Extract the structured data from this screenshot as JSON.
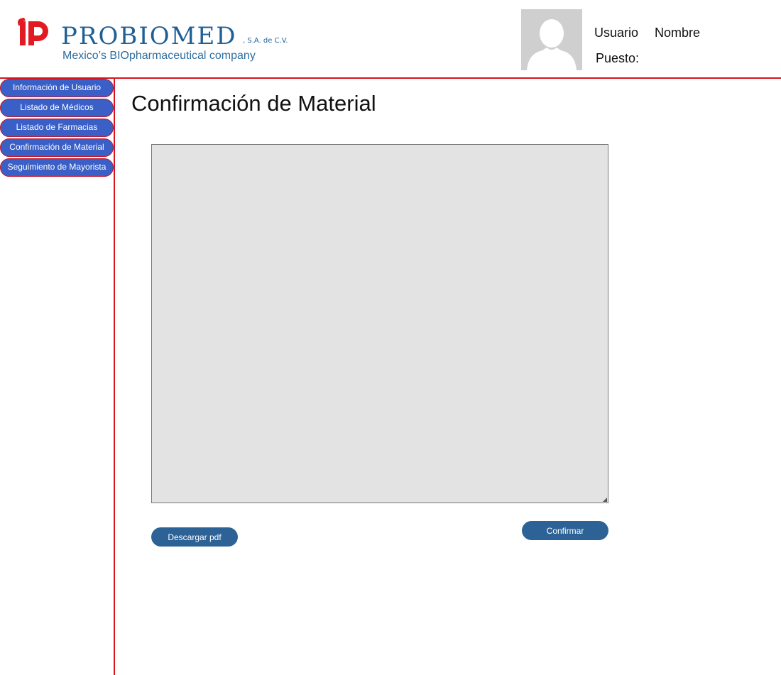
{
  "header": {
    "logo": {
      "name": "PROBIOMED",
      "suffix": ", S.A. de C.V.",
      "tagline": "Mexico’s BIOpharmaceutical company",
      "brand_color": "#1f5f94",
      "mark_color": "#e21b23"
    },
    "user": {
      "label": "Usuario",
      "name": "Nombre",
      "position_label": "Puesto:",
      "avatar_icon": "user-silhouette-icon"
    }
  },
  "sidebar": {
    "items": [
      {
        "label": "Información de Usuario"
      },
      {
        "label": "Listado de Médicos"
      },
      {
        "label": "Listado de Farmacias"
      },
      {
        "label": "Confirmación de Material"
      },
      {
        "label": "Seguimiento de Mayorista"
      }
    ]
  },
  "main": {
    "title": "Confirmación de Material",
    "download_label": "Descargar pdf",
    "confirm_label": "Confirmar"
  },
  "colors": {
    "accent_red": "#d8141c",
    "nav_blue": "#3a5fc6",
    "button_blue": "#2d6296",
    "document_bg": "#e3e3e3"
  }
}
